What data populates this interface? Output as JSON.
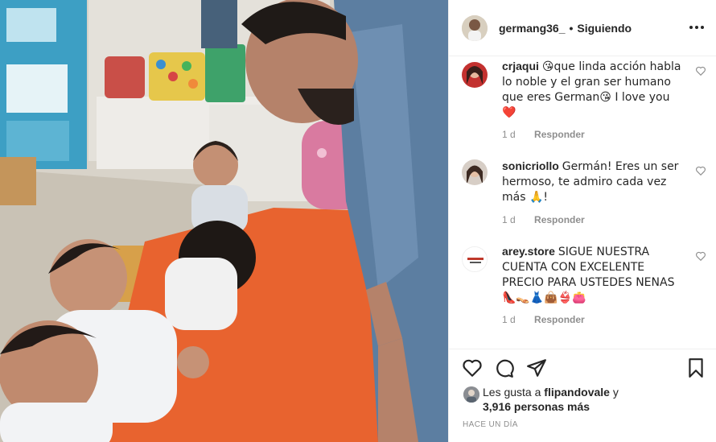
{
  "header": {
    "username": "germang36_",
    "separator": "•",
    "follow_status": "Siguiendo",
    "more_icon": "more-options-icon"
  },
  "comments": [
    {
      "username": "crjaqui",
      "text": "😘que linda acción habla lo noble y el gran ser humano que eres German😘 I love you ❤️",
      "time": "1 d",
      "reply_label": "Responder"
    },
    {
      "username": "sonicriollo",
      "text": "Germán! Eres un ser hermoso, te admiro cada vez más 🙏!",
      "time": "1 d",
      "reply_label": "Responder"
    },
    {
      "username": "arey.store",
      "text": "SIGUE NUESTRA CUENTA CON EXCELENTE PRECIO PARA USTEDES NENAS 👠👡👗👜👙👛",
      "time": "1 d",
      "reply_label": "Responder"
    }
  ],
  "actions": {
    "like_icon": "heart-icon",
    "comment_icon": "comment-icon",
    "share_icon": "share-icon",
    "save_icon": "bookmark-icon"
  },
  "likes": {
    "prefix": "Les gusta a",
    "user": "flipandovale",
    "conjunction": "y",
    "others": "3,916 personas más"
  },
  "timestamp": "HACE UN DÍA",
  "colors": {
    "text": "#262626",
    "muted": "#8e8e8e",
    "border": "#efefef",
    "table": "#e8632f"
  }
}
